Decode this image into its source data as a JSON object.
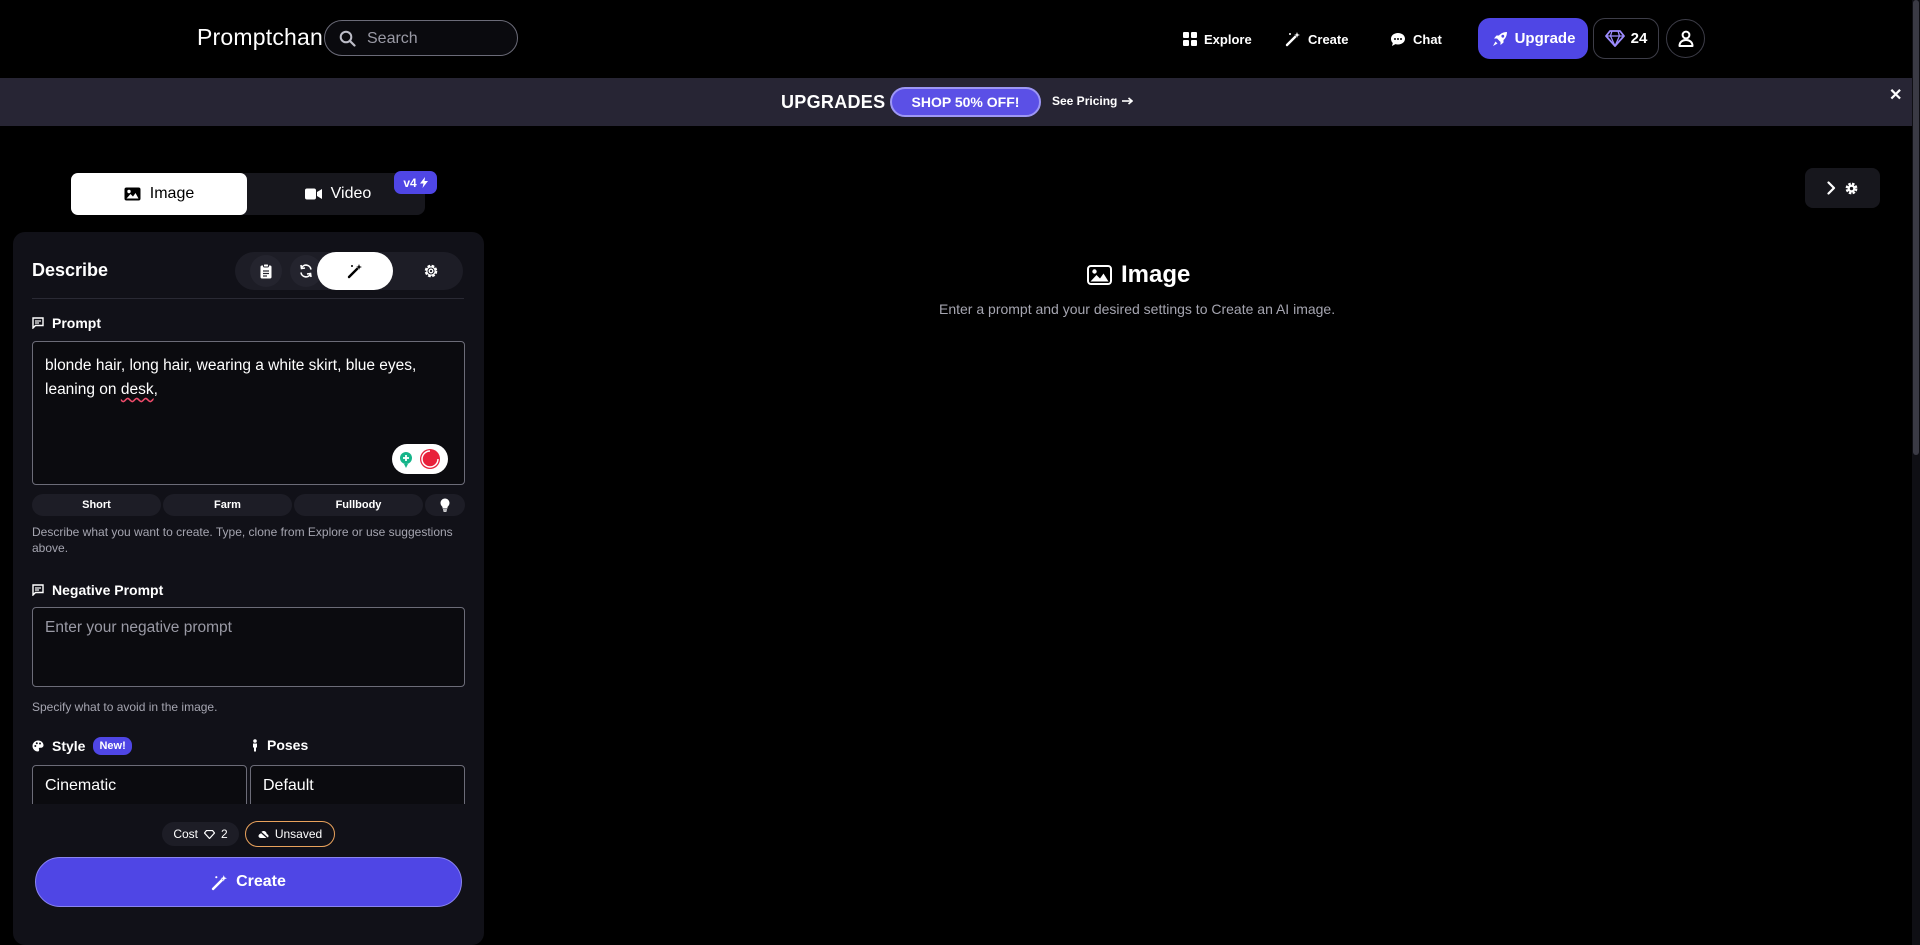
{
  "nav": {
    "brand": "Promptchan",
    "search_placeholder": "Search",
    "links": {
      "explore": "Explore",
      "create": "Create",
      "chat": "Chat"
    },
    "upgrade_label": "Upgrade",
    "gem_count": "24",
    "icons": {
      "search": "search-icon",
      "explore": "grid-icon",
      "create": "magic-wand-icon",
      "chat": "chat-bubble-icon",
      "upgrade": "rocket-icon",
      "gems": "diamond-icon",
      "profile": "user-icon"
    }
  },
  "banner": {
    "title": "UPGRADES",
    "shop_label": "SHOP 50% OFF!",
    "pricing_label": "See Pricing",
    "close_symbol": "✕"
  },
  "mode_tabs": {
    "image_label": "Image",
    "video_label": "Video",
    "version_badge": "v4"
  },
  "panel": {
    "title": "Describe",
    "prompt_label": "Prompt",
    "prompt_text_main": "blonde hair, long hair, wearing a white skirt, blue eyes, leaning on ",
    "prompt_text_flagged": "desk",
    "prompt_text_end": ",",
    "suggestions": [
      "Short",
      "Farm",
      "Fullbody"
    ],
    "prompt_hint": "Describe what you want to create. Type, clone from Explore or use suggestions above.",
    "negative_label": "Negative Prompt",
    "negative_placeholder": "Enter your negative prompt",
    "negative_hint": "Specify what to avoid in the image.",
    "style_label": "Style",
    "style_badge": "New!",
    "style_value": "Cinematic",
    "poses_label": "Poses",
    "poses_value": "Default",
    "cost_label": "Cost",
    "cost_value": "2",
    "unsaved_label": "Unsaved",
    "create_label": "Create"
  },
  "canvas": {
    "title": "Image",
    "subtitle": "Enter a prompt and your desired settings to Create an AI image."
  },
  "colors": {
    "accent": "#4f46e5",
    "banner_bg": "#272534",
    "panel_bg": "#111118",
    "unsaved_border": "#e9a25c",
    "spell_error": "#ef4b6a"
  }
}
